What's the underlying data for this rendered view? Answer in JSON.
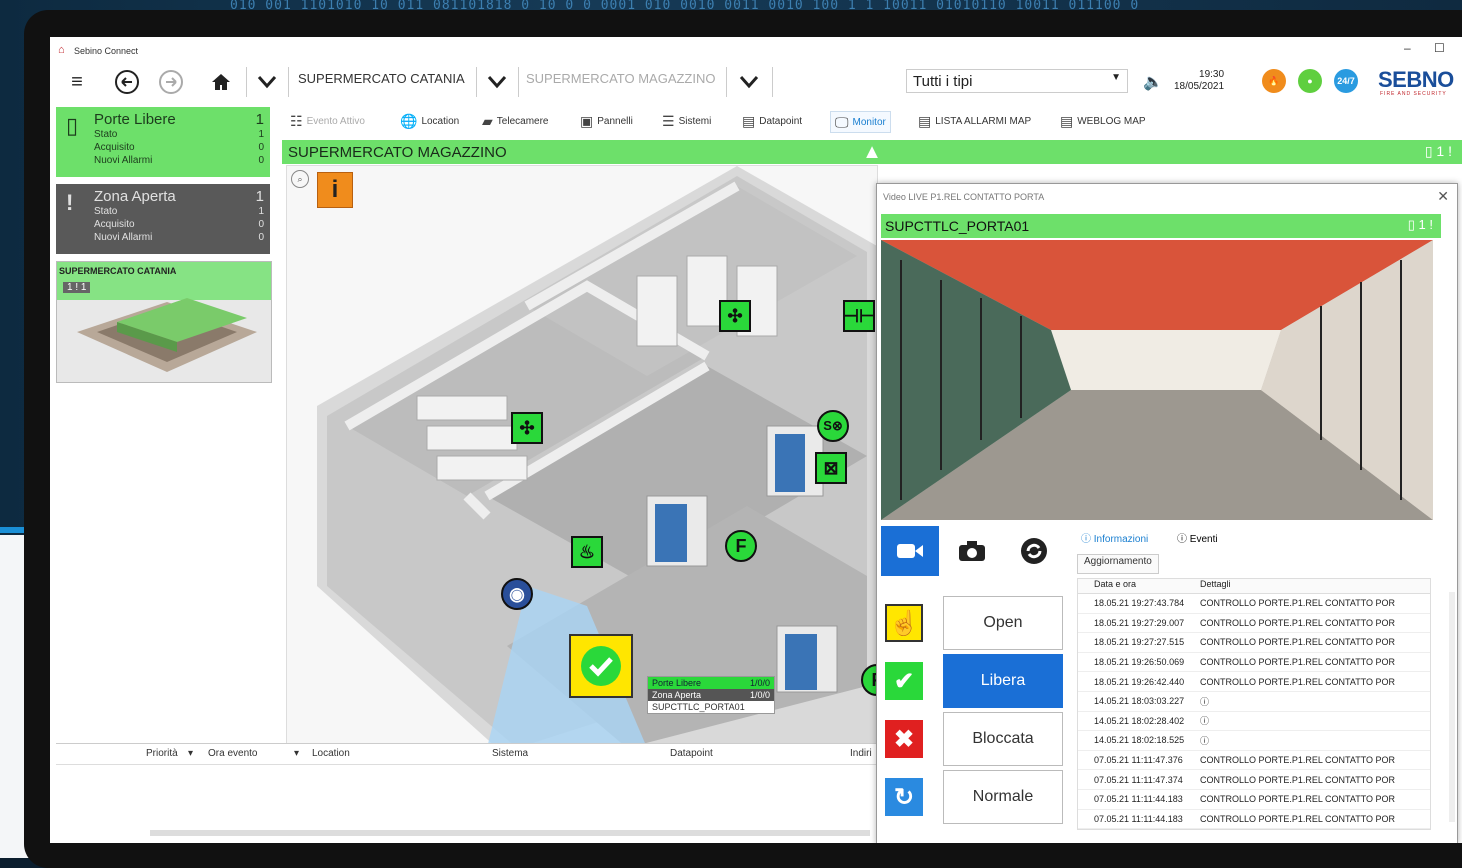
{
  "background": {
    "binary_text": "010 001 1101010 10 011 081101818 0 10 0 0 0001 010 0010 0011 0010 100 1 1 10011 01010110 10011 011100 0"
  },
  "window": {
    "app_name": "Sebino Connect",
    "min_label": "–",
    "max_label": "☐"
  },
  "toolbar": {
    "breadcrumb_1": "SUPERMERCATO CATANIA",
    "breadcrumb_2": "SUPERMERCATO MAGAZZINO",
    "filter_value": "Tutti i tipi",
    "time": "19:30",
    "date": "18/05/2021",
    "brand": "SEBNO",
    "brand_sub": "FIRE AND SECURITY",
    "badge_label": "24/7"
  },
  "left_panel": {
    "cards": [
      {
        "title": "Porte Libere",
        "count": "1",
        "rows": [
          {
            "label": "Stato",
            "value": "1"
          },
          {
            "label": "Acquisito",
            "value": "0"
          },
          {
            "label": "Nuovi Allarmi",
            "value": "0"
          }
        ]
      },
      {
        "title": "Zona Aperta",
        "count": "1",
        "rows": [
          {
            "label": "Stato",
            "value": "1"
          },
          {
            "label": "Acquisito",
            "value": "0"
          },
          {
            "label": "Nuovi Allarmi",
            "value": "0"
          }
        ]
      }
    ],
    "site": {
      "title": "SUPERMERCATO CATANIA",
      "count_a": "1",
      "count_b": "1"
    }
  },
  "nav_tabs": [
    {
      "label": "Evento Attivo",
      "icon": "event-icon"
    },
    {
      "label": "Location",
      "icon": "globe-icon"
    },
    {
      "label": "Telecamere",
      "icon": "camera-icon"
    },
    {
      "label": "Pannelli",
      "icon": "panel-icon"
    },
    {
      "label": "Sistemi",
      "icon": "systems-icon"
    },
    {
      "label": "Datapoint",
      "icon": "datapoint-icon"
    },
    {
      "label": "Monitor",
      "icon": "monitor-icon"
    },
    {
      "label": "LISTA ALLARMI MAP",
      "icon": "list-icon"
    },
    {
      "label": "WEBLOG MAP",
      "icon": "weblog-icon"
    }
  ],
  "map": {
    "title": "SUPERMERCATO MAGAZZINO",
    "count": "1",
    "tooltip": {
      "row1_label": "Porte Libere",
      "row1_value": "1/0/0",
      "row2_label": "Zona Aperta",
      "row2_value": "1/0/0",
      "name": "SUPCTTLC_PORTA01"
    }
  },
  "events_table": {
    "columns": [
      "Priorità",
      "Ora evento",
      "Location",
      "Sistema",
      "Datapoint",
      "Indiri"
    ]
  },
  "video_panel": {
    "window_title": "Video LIVE P1.REL CONTATTO PORTA",
    "device_name": "SUPCTTLC_PORTA01",
    "count": "1",
    "actions": [
      "Open",
      "Libera",
      "Bloccata",
      "Normale"
    ],
    "tabs": [
      "Informazioni",
      "Eventi"
    ],
    "refresh_label": "Aggiornamento",
    "log_columns": [
      "Data e ora",
      "Dettagli"
    ],
    "log_rows": [
      {
        "time": "18.05.21 19:27:43.784",
        "detail": "CONTROLLO PORTE.P1.REL CONTATTO POR"
      },
      {
        "time": "18.05.21 19:27:29.007",
        "detail": "CONTROLLO PORTE.P1.REL CONTATTO POR"
      },
      {
        "time": "18.05.21 19:27:27.515",
        "detail": "CONTROLLO PORTE.P1.REL CONTATTO POR"
      },
      {
        "time": "18.05.21 19:26:50.069",
        "detail": "CONTROLLO PORTE.P1.REL CONTATTO POR"
      },
      {
        "time": "18.05.21 19:26:42.440",
        "detail": "CONTROLLO PORTE.P1.REL CONTATTO POR"
      },
      {
        "time": "14.05.21 18:03:03.227",
        "detail": "ⓘ"
      },
      {
        "time": "14.05.21 18:02:28.402",
        "detail": "ⓘ"
      },
      {
        "time": "14.05.21 18:02:18.525",
        "detail": "ⓘ"
      },
      {
        "time": "07.05.21 11:11:47.376",
        "detail": "CONTROLLO PORTE.P1.REL CONTATTO POR"
      },
      {
        "time": "07.05.21 11:11:47.374",
        "detail": "CONTROLLO PORTE.P1.REL CONTATTO POR"
      },
      {
        "time": "07.05.21 11:11:44.183",
        "detail": "CONTROLLO PORTE.P1.REL CONTATTO POR"
      },
      {
        "time": "07.05.21 11:11:44.183",
        "detail": "CONTROLLO PORTE.P1.REL CONTATTO POR"
      }
    ]
  },
  "colors": {
    "accent_green": "#6de06a",
    "active_blue": "#1a6fd6",
    "brand_blue": "#1a4e9a",
    "alert_orange": "#f08c1c"
  }
}
